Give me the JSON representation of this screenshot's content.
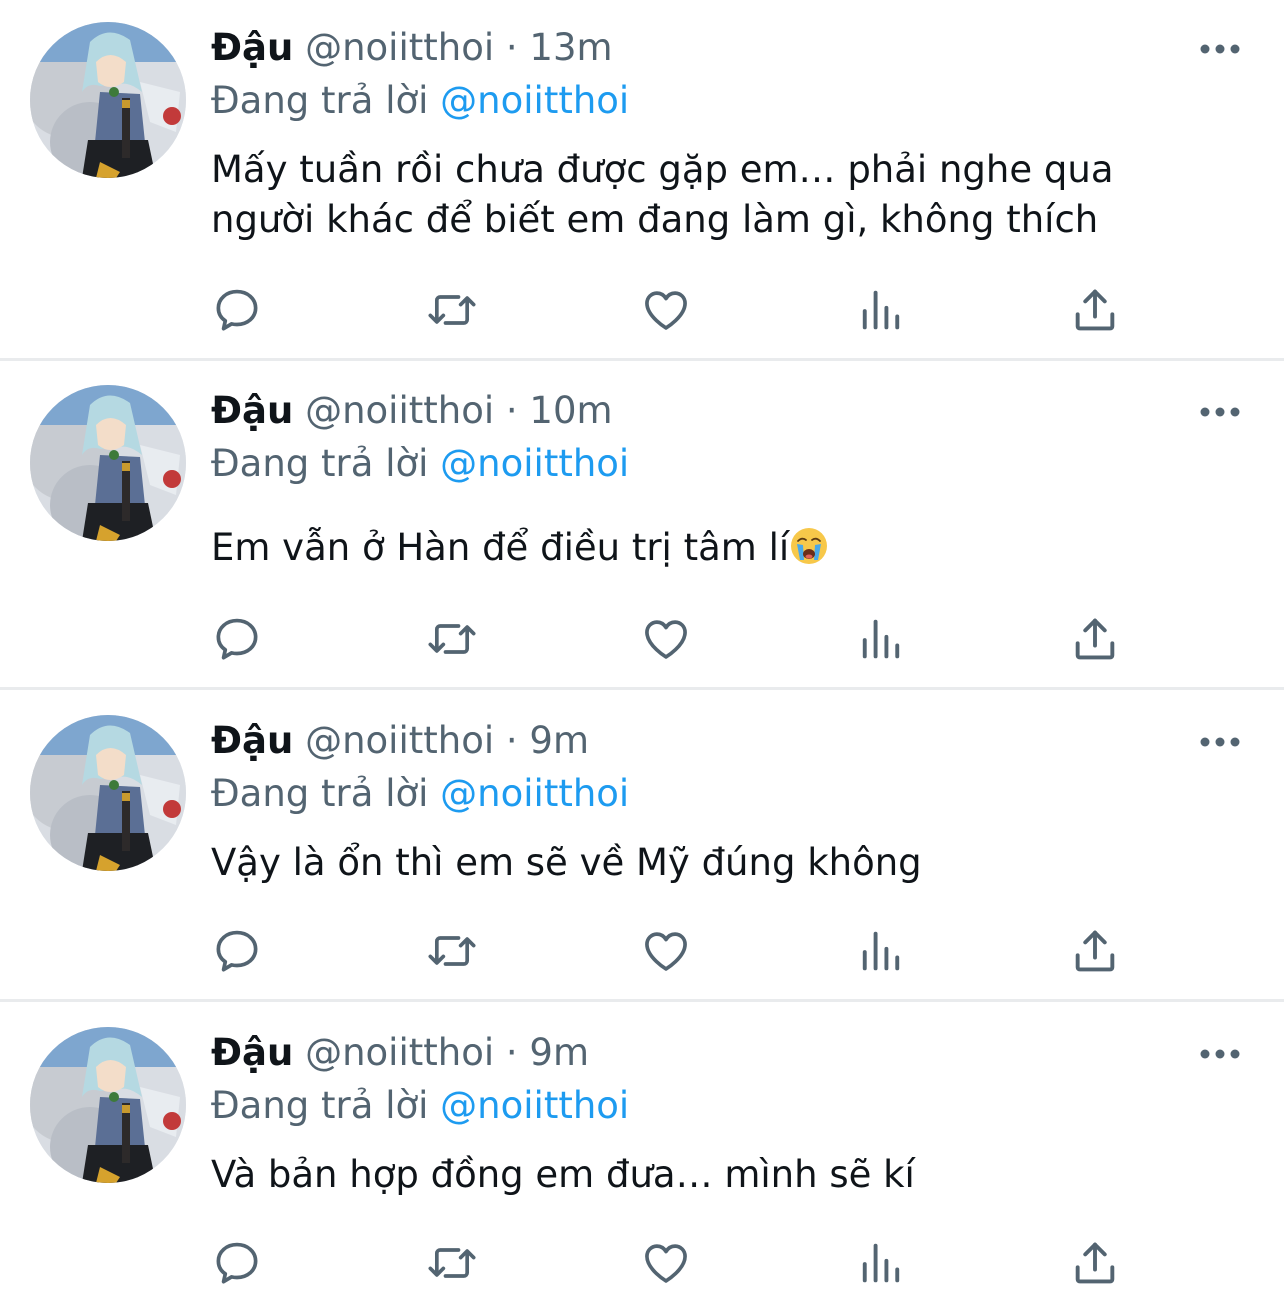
{
  "tweets": [
    {
      "name": "Đậu",
      "handle": "@noiitthoi",
      "separator": "·",
      "time": "13m",
      "reply_prefix": "Đang trả lời",
      "reply_to": "@noiitthoi",
      "text": "Mấy tuần rồi chưa được gặp em… phải nghe qua người khác để biết em đang làm gì, không thích"
    },
    {
      "name": "Đậu",
      "handle": "@noiitthoi",
      "separator": "·",
      "time": "10m",
      "reply_prefix": "Đang trả lời",
      "reply_to": "@noiitthoi",
      "text": "Em vẫn ở Hàn để điều trị tâm lí",
      "trailing_emoji": "loudly-crying-face-emoji"
    },
    {
      "name": "Đậu",
      "handle": "@noiitthoi",
      "separator": "·",
      "time": "9m",
      "reply_prefix": "Đang trả lời",
      "reply_to": "@noiitthoi",
      "text": "Vậy là ổn thì em sẽ về Mỹ đúng không"
    },
    {
      "name": "Đậu",
      "handle": "@noiitthoi",
      "separator": "·",
      "time": "9m",
      "reply_prefix": "Đang trả lời",
      "reply_to": "@noiitthoi",
      "text": "Và bản hợp đồng em đưa… mình sẽ kí"
    }
  ],
  "icons": {
    "more": "more-horizontal-icon",
    "reply": "reply-bubble-icon",
    "retweet": "retweet-icon",
    "like": "heart-icon",
    "views": "views-bar-chart-icon",
    "share": "share-upload-icon"
  },
  "colors": {
    "text": "#0f1419",
    "secondary": "#536471",
    "accent": "#1d9bf0",
    "divider": "#e9ebed"
  }
}
